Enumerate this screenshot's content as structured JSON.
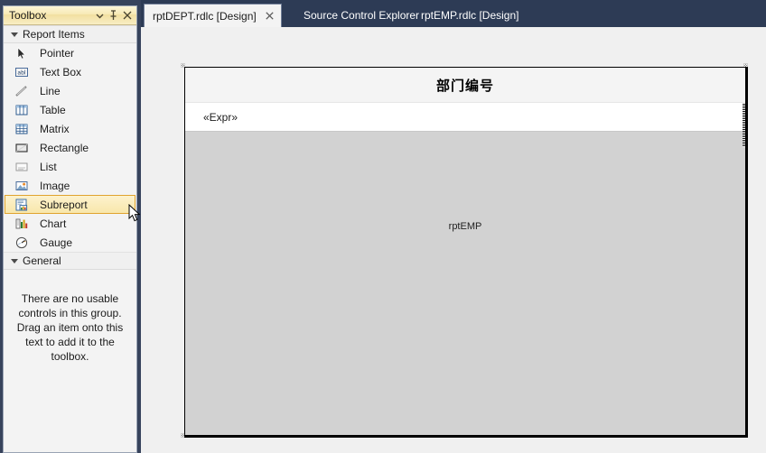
{
  "toolbox": {
    "caption": "Toolbox",
    "caption_buttons": [
      {
        "name": "dropdown",
        "glyph": "▾"
      },
      {
        "name": "pin",
        "glyph": "pin-icon"
      },
      {
        "name": "close",
        "glyph": "✕"
      }
    ],
    "groups": [
      {
        "label": "Report Items",
        "expanded": true,
        "items": [
          {
            "label": "Pointer",
            "icon": "pointer-icon",
            "selected": false
          },
          {
            "label": "Text Box",
            "icon": "textbox-icon",
            "selected": false
          },
          {
            "label": "Line",
            "icon": "line-icon",
            "selected": false
          },
          {
            "label": "Table",
            "icon": "table-icon",
            "selected": false
          },
          {
            "label": "Matrix",
            "icon": "matrix-icon",
            "selected": false
          },
          {
            "label": "Rectangle",
            "icon": "rectangle-icon",
            "selected": false
          },
          {
            "label": "List",
            "icon": "list-icon",
            "selected": false
          },
          {
            "label": "Image",
            "icon": "image-icon",
            "selected": false
          },
          {
            "label": "Subreport",
            "icon": "subreport-icon",
            "selected": true
          },
          {
            "label": "Chart",
            "icon": "chart-icon",
            "selected": false
          },
          {
            "label": "Gauge",
            "icon": "gauge-icon",
            "selected": false
          }
        ]
      },
      {
        "label": "General",
        "expanded": true,
        "empty_message": "There are no usable controls in this group. Drag an item onto this text to add it to the toolbox."
      }
    ],
    "highlight_color": "#f8e7ab",
    "highlight_border_color": "#e0a32e"
  },
  "tabs": [
    {
      "label": "rptDEPT.rdlc [Design]",
      "active": true,
      "closable": true,
      "close_glyph": "✕"
    },
    {
      "label": "Source Control Explorer",
      "active": false,
      "closable": false
    },
    {
      "label": "rptEMP.rdlc [Design]",
      "active": false,
      "closable": false
    }
  ],
  "designer": {
    "report_title": "部门编号",
    "expression_placeholder": "«Expr»",
    "subreport_name": "rptEMP",
    "surface_color": "#d2d2d2",
    "header_color": "#f4f4f4",
    "body_color": "#ffffff"
  }
}
